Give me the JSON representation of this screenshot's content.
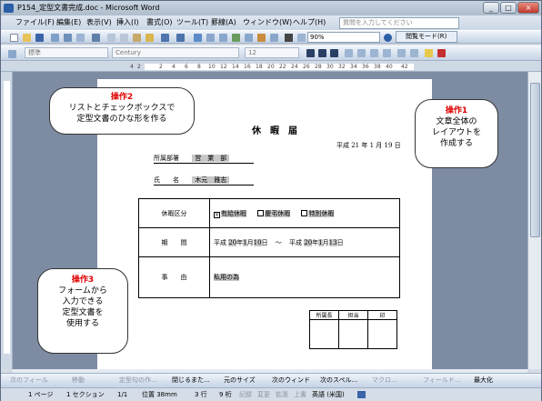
{
  "window": {
    "title": "P154_定型文書完成.doc - Microsoft Word",
    "min": "_",
    "max": "□",
    "close": "×"
  },
  "menu": [
    "ファイル(F)",
    "編集(E)",
    "表示(V)",
    "挿入(I)",
    "書式(O)",
    "ツール(T)",
    "罫線(A)",
    "ウィンドウ(W)",
    "ヘルプ(H)"
  ],
  "ask_placeholder": "質問を入力してください",
  "toolbar": {
    "zoom": "90%",
    "reading_mode": "閲覧モード(R)"
  },
  "format_toolbar": {
    "style": "標準",
    "font": "Century",
    "size": "12"
  },
  "ruler": {
    "ticks": [
      "4",
      "2",
      "2",
      "4",
      "6",
      "8",
      "10",
      "12",
      "14",
      "16",
      "18",
      "20",
      "22",
      "24",
      "26",
      "28",
      "30",
      "32",
      "34",
      "36",
      "38",
      "40",
      "42"
    ]
  },
  "document": {
    "title": "休　暇　届",
    "date": "平成 21 年 1 月 19 日",
    "dept_label": "所属部署",
    "dept_value": "営　業　部",
    "name_label": "氏　　名",
    "name_value": "木元　雅志",
    "table": {
      "kind_label": "休暇区分",
      "options": [
        {
          "label": "有給休暇",
          "checked": true
        },
        {
          "label": "慶弔休暇",
          "checked": false
        },
        {
          "label": "特別休暇",
          "checked": false
        }
      ],
      "period_label": "期　　間",
      "period": {
        "era1": "平成",
        "y1": "20",
        "m1": "1",
        "d1": "10",
        "tilde": "～",
        "era2": "平成",
        "y2": "20",
        "m2": "1",
        "d2": "13",
        "nen": "年",
        "tsuki": "月",
        "nichi": "日"
      },
      "reason_label": "事　　由",
      "reason_value": "私用の為"
    },
    "stamp_headers": [
      "所属長",
      "担当",
      "印"
    ]
  },
  "callouts": {
    "op1_title": "操作1",
    "op1_body": [
      "文章全体の",
      "レイアウトを",
      "作成する"
    ],
    "op2_title": "操作2",
    "op2_body": [
      "リストとチェックボックスで",
      "定型文書のひな形を作る"
    ],
    "op3_title": "操作3",
    "op3_body": [
      "フォームから",
      "入力できる",
      "定型文書を",
      "使用する"
    ]
  },
  "form_toolbar": {
    "items": [
      {
        "label": "次のフィール",
        "on": false
      },
      {
        "label": "移動",
        "on": false
      },
      {
        "label": "定型句の作...",
        "on": false
      },
      {
        "label": "閉じるまた...",
        "on": true
      },
      {
        "label": "元のサイズ",
        "on": true
      },
      {
        "label": "次のウィンド",
        "on": true
      },
      {
        "label": "次のスペル...",
        "on": true
      },
      {
        "label": "マクロ...",
        "on": false
      },
      {
        "label": "フィールド...",
        "on": false
      },
      {
        "label": "最大化",
        "on": true
      }
    ]
  },
  "status": {
    "page": "1 ページ",
    "section": "1 セクション",
    "pages": "1/1",
    "position": "位置 38mm",
    "line": "3 行",
    "column": "9 桁",
    "rec": "記録",
    "trk": "変更",
    "ext": "拡張",
    "ovr": "上書",
    "lang": "英語 (米国)"
  }
}
